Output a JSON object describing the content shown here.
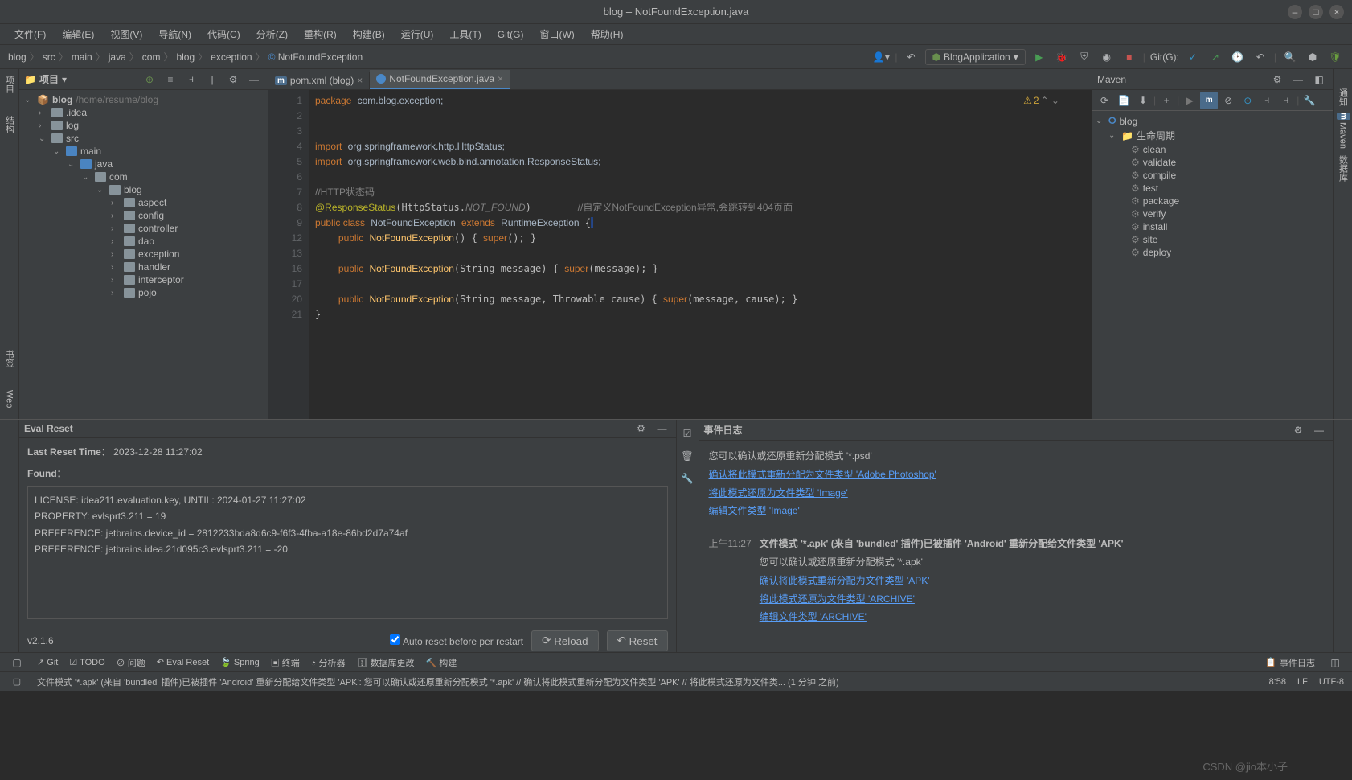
{
  "window": {
    "title": "blog – NotFoundException.java"
  },
  "menu": [
    "文件(F)",
    "编辑(E)",
    "视图(V)",
    "导航(N)",
    "代码(C)",
    "分析(Z)",
    "重构(R)",
    "构建(B)",
    "运行(U)",
    "工具(T)",
    "Git(G)",
    "窗口(W)",
    "帮助(H)"
  ],
  "breadcrumbs": [
    "blog",
    "src",
    "main",
    "java",
    "com",
    "blog",
    "exception",
    "NotFoundException"
  ],
  "run_config": "BlogApplication",
  "git_label": "Git(G):",
  "project": {
    "panel_title": "项目",
    "root": {
      "name": "blog",
      "path": "/home/resume/blog"
    },
    "nodes": [
      {
        "indent": 1,
        "name": ".idea",
        "arrow": "›"
      },
      {
        "indent": 1,
        "name": "log",
        "arrow": "›"
      },
      {
        "indent": 1,
        "name": "src",
        "arrow": "⌄"
      },
      {
        "indent": 2,
        "name": "main",
        "arrow": "⌄",
        "blue": true
      },
      {
        "indent": 3,
        "name": "java",
        "arrow": "⌄",
        "blue": true
      },
      {
        "indent": 4,
        "name": "com",
        "arrow": "⌄"
      },
      {
        "indent": 5,
        "name": "blog",
        "arrow": "⌄"
      },
      {
        "indent": 6,
        "name": "aspect",
        "arrow": "›"
      },
      {
        "indent": 6,
        "name": "config",
        "arrow": "›"
      },
      {
        "indent": 6,
        "name": "controller",
        "arrow": "›"
      },
      {
        "indent": 6,
        "name": "dao",
        "arrow": "›"
      },
      {
        "indent": 6,
        "name": "exception",
        "arrow": "›"
      },
      {
        "indent": 6,
        "name": "handler",
        "arrow": "›"
      },
      {
        "indent": 6,
        "name": "interceptor",
        "arrow": "›"
      },
      {
        "indent": 6,
        "name": "pojo",
        "arrow": "›"
      }
    ]
  },
  "tabs": [
    {
      "label": "pom.xml (blog)",
      "icon": "m",
      "active": false
    },
    {
      "label": "NotFoundException.java",
      "icon": "java",
      "active": true
    }
  ],
  "editor": {
    "warnings": "2",
    "lines": [
      "1",
      "2",
      "3",
      "4",
      "5",
      "6",
      "7",
      "8",
      "9",
      "12",
      "",
      "13",
      "",
      "16",
      "17",
      "20",
      "21"
    ]
  },
  "maven": {
    "title": "Maven",
    "root": "blog",
    "lifecycle": "生命周期",
    "goals": [
      "clean",
      "validate",
      "compile",
      "test",
      "package",
      "verify",
      "install",
      "site",
      "deploy"
    ]
  },
  "right_gutter": [
    "通知",
    "Maven",
    "数据库"
  ],
  "left_gutter": [
    "项目",
    "结构",
    "书签",
    "Web"
  ],
  "eval": {
    "title": "Eval Reset",
    "last_reset_label": "Last Reset Time：",
    "last_reset_value": "2023-12-28 11:27:02",
    "found_label": "Found：",
    "found_lines": [
      "LICENSE: idea211.evaluation.key, UNTIL: 2024-01-27 11:27:02",
      "PROPERTY: evlsprt3.211 = 19",
      "PREFERENCE: jetbrains.device_id = 2812233bda8d6c9-f6f3-4fba-a18e-86bd2d7a74af",
      "PREFERENCE: jetbrains.idea.21d095c3.evlsprt3.211 = -20"
    ],
    "version": "v2.1.6",
    "auto_reset": "Auto reset before per restart",
    "reload_btn": "Reload",
    "reset_btn": "Reset"
  },
  "event_log": {
    "title": "事件日志",
    "block1": {
      "text": "您可以确认或还原重新分配模式 '*.psd'",
      "link1": "确认将此模式重新分配为文件类型 'Adobe Photoshop'",
      "link2": "将此模式还原为文件类型 'Image'",
      "link3": "编辑文件类型 'Image'"
    },
    "block2": {
      "time": "上午11:27",
      "title": "文件模式 '*.apk' (来自 'bundled' 插件)已被插件 'Android' 重新分配给文件类型 'APK'",
      "text": "您可以确认或还原重新分配模式 '*.apk'",
      "link1": "确认将此模式重新分配为文件类型 'APK'",
      "link2": "将此模式还原为文件类型 'ARCHIVE'",
      "link3": "编辑文件类型 'ARCHIVE'"
    }
  },
  "tool_windows": [
    "Git",
    "TODO",
    "问题",
    "Eval Reset",
    "Spring",
    "终端",
    "分析器",
    "数据库更改",
    "构建"
  ],
  "tool_windows_right": "事件日志",
  "status": {
    "message": "文件模式 '*.apk' (来自 'bundled' 插件)已被插件 'Android' 重新分配给文件类型 'APK': 您可以确认或还原重新分配模式 '*.apk' // 确认将此模式重新分配为文件类型 'APK' // 将此模式还原为文件类... (1 分钟 之前)",
    "pos": "8:58",
    "sep": "LF",
    "enc": "UTF-8"
  },
  "watermark": "CSDN @jio本小子"
}
